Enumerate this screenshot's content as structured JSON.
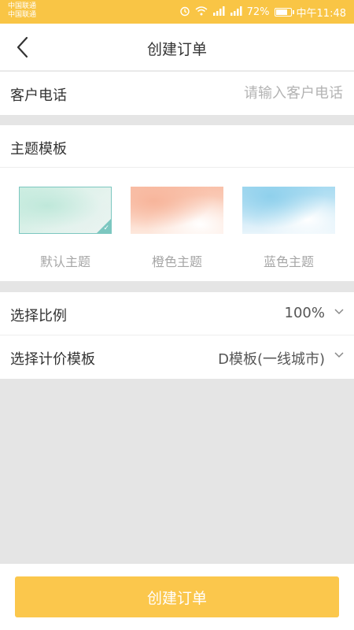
{
  "status_bar": {
    "carrier_1": "中国联通",
    "carrier_2": "中国联通",
    "battery": "72%",
    "time": "中午11:48",
    "icons": [
      "alarm-icon",
      "wifi-icon",
      "signal-icon",
      "signal-icon",
      "battery-icon"
    ]
  },
  "nav": {
    "title": "创建订单",
    "back_icon": "chevron-left-icon"
  },
  "phone": {
    "label": "客户电话",
    "placeholder": "请输入客户电话",
    "value": ""
  },
  "themes": {
    "label": "主题模板",
    "items": [
      {
        "name": "默认主题",
        "selected": true
      },
      {
        "name": "橙色主题",
        "selected": false
      },
      {
        "name": "蓝色主题",
        "selected": false
      }
    ]
  },
  "ratio": {
    "label": "选择比例",
    "value": "100%"
  },
  "pricing": {
    "label": "选择计价模板",
    "value": "D模板(一线城市)"
  },
  "submit": {
    "label": "创建订单"
  },
  "colors": {
    "accent": "#f9c545",
    "button": "#fbc74c",
    "selected_border": "#7cc7c0"
  }
}
